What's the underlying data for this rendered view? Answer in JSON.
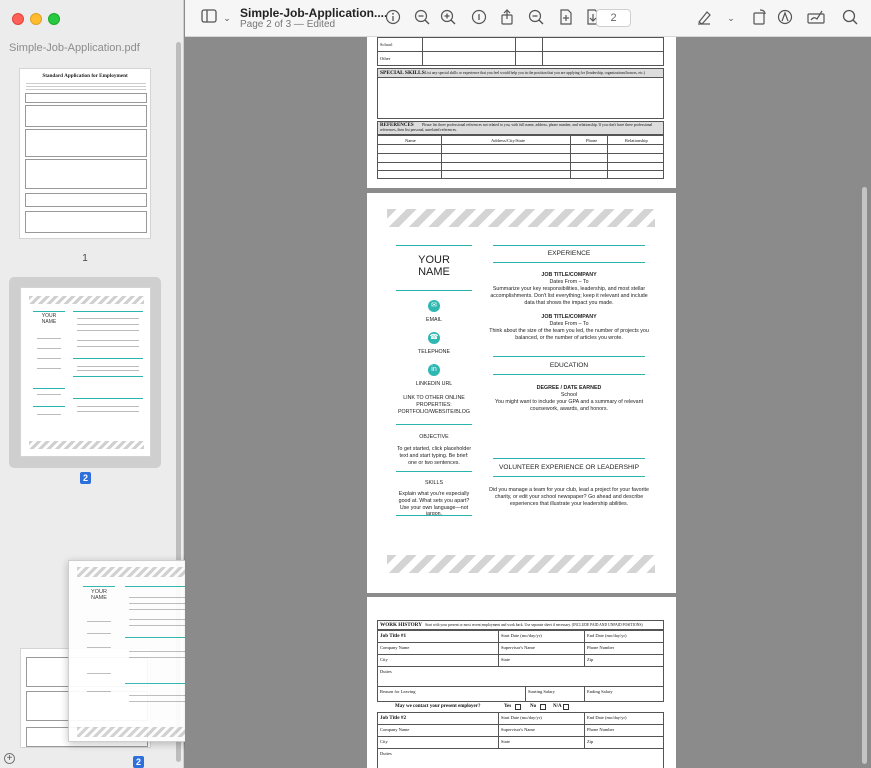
{
  "window": {
    "doc_title": "Simple-Job-Application....",
    "doc_subtitle": "Page 2 of 3 — Edited",
    "page_field_value": "2"
  },
  "sidebar": {
    "filename": "Simple-Job-Application.pdf",
    "thumbnails": [
      {
        "page_label": "1",
        "heading": "Standard Application for Employment"
      },
      {
        "page_label": "2",
        "heading": "YOUR NAME"
      },
      {
        "page_label": "2"
      }
    ]
  },
  "toolbar_icons": [
    "sidebar-toggle-icon",
    "chevron-down-icon",
    "info-icon",
    "zoom-out-icon",
    "zoom-in-icon",
    "info-circle-icon",
    "share-icon",
    "search-zoom-icon",
    "insert-page-icon",
    "download-icon",
    "highlight-icon",
    "chevron-down-icon",
    "rotate-icon",
    "markup-icon",
    "sign-icon",
    "search-icon"
  ],
  "page_top": {
    "rows": [
      "School",
      "Other"
    ],
    "special_skills_title": "SPECIAL SKILLS",
    "special_skills_text": "List any special skills or experience that you feel would help you in the position that you are applying for (leadership, organizations/honors, etc.)",
    "references_title": "REFERENCES",
    "references_text": "Please list three professional references not related to you, with full name, address, phone number, and relationship. If you don't have three professional references, then list personal, unrelated references.",
    "ref_columns": [
      "Name",
      "Address/City/State",
      "Phone",
      "Relationship"
    ]
  },
  "resume": {
    "name_line1": "YOUR",
    "name_line2": "NAME",
    "email": "EMAIL",
    "telephone": "TELEPHONE",
    "linkedin": "LINKEDIN URL",
    "link_other": "LINK TO OTHER ONLINE PROPERTIES: PORTFOLIO/WEBSITE/BLOG",
    "objective_title": "OBJECTIVE",
    "objective_text": "To get started, click placeholder text and start typing. Be brief: one or two sentences.",
    "skills_title": "SKILLS",
    "skills_text": "Explain what you're especially good at. What sets you apart? Use your own language—not jargon.",
    "experience_title": "EXPERIENCE",
    "job1_title": "JOB TITLE/COMPANY",
    "job1_dates": "Dates From – To",
    "job1_text": "Summarize your key responsibilities, leadership, and most stellar accomplishments. Don't list everything; keep it relevant and include data that shows the impact you made.",
    "job2_title": "JOB TITLE/COMPANY",
    "job2_dates": "Dates From – To",
    "job2_text": "Think about the size of the team you led, the number of projects you balanced, or the number of articles you wrote.",
    "education_title": "EDUCATION",
    "degree": "DEGREE / DATE EARNED",
    "school": "School",
    "edu_text": "You might want to include your GPA and a summary of relevant coursework, awards, and honors.",
    "volunteer_title": "VOLUNTEER EXPERIENCE OR LEADERSHIP",
    "volunteer_text": "Did you manage a team for your club, lead a project for your favorite charity, or edit your school newspaper? Go ahead and describe experiences that illustrate your leadership abilities."
  },
  "page_bottom": {
    "work_history_title": "WORK HISTORY",
    "work_history_text": "Start with your present or most recent employment and work back. Use separate sheet if necessary. (INCLUDE PAID AND UNPAID POSITIONS)",
    "job1_label": "Job Title #1",
    "job2_label": "Job Title #2",
    "start_date": "Start Date (mo/day/yr)",
    "end_date": "End Date (mo/day/yr)",
    "company": "Company Name",
    "supervisor": "Supervisor's Name",
    "phone": "Phone Number",
    "city": "City",
    "state": "State",
    "zip": "Zip",
    "duties": "Duties",
    "reason": "Reason for Leaving",
    "start_salary": "Starting Salary",
    "end_salary": "Ending Salary",
    "contact_question": "May we contact your present employer?",
    "yes": "Yes",
    "no": "No",
    "na": "N/A"
  }
}
